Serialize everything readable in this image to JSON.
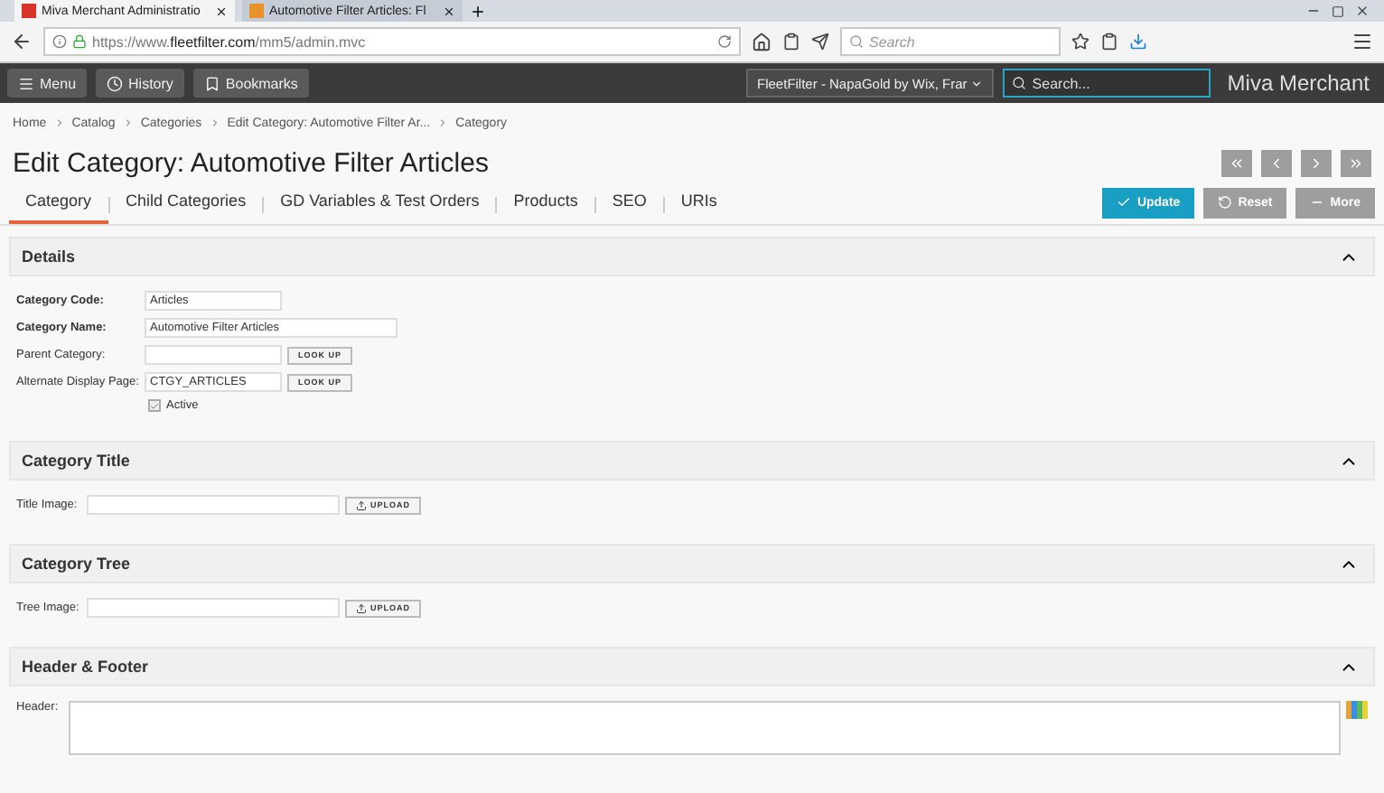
{
  "browser": {
    "tabs": [
      {
        "title": "Miva Merchant Administratio",
        "selected": true
      },
      {
        "title": "Automotive Filter Articles: Fl",
        "selected": false
      }
    ],
    "url_prefix": "https://www.",
    "url_domain": "fleetfilter.com",
    "url_path": "/mm5/admin.mvc",
    "search_placeholder": "Search"
  },
  "appbar": {
    "buttons": [
      "Menu",
      "History",
      "Bookmarks"
    ],
    "store": "FleetFilter - NapaGold by Wix, Frar",
    "search_placeholder": "Search...",
    "brand": "Miva Merchant"
  },
  "breadcrumbs": [
    "Home",
    "Catalog",
    "Categories",
    "Edit Category: Automotive Filter Ar...",
    "Category"
  ],
  "title": "Edit Category: Automotive Filter Articles",
  "tabs": [
    {
      "label": "Category",
      "selected": true
    },
    {
      "label": "Child Categories",
      "selected": false
    },
    {
      "label": "GD Variables & Test Orders",
      "selected": false
    },
    {
      "label": "Products",
      "selected": false
    },
    {
      "label": "SEO",
      "selected": false
    },
    {
      "label": "URIs",
      "selected": false
    }
  ],
  "actions": [
    {
      "label": "Update",
      "kind": "primary"
    },
    {
      "label": "Reset",
      "kind": "reset"
    },
    {
      "label": "More",
      "kind": "more"
    }
  ],
  "sections": [
    {
      "title": "Details",
      "expanded": true,
      "fields": [
        {
          "kind": "text",
          "label": "Category Code:",
          "bold": true,
          "value": "Articles"
        },
        {
          "kind": "text",
          "label": "Category Name:",
          "bold": true,
          "value": "Automotive Filter Articles"
        },
        {
          "kind": "lookup",
          "label": "Parent Category:",
          "bold": false,
          "button": "LOOK UP"
        },
        {
          "kind": "lookup",
          "label": "Alternate Display Page:",
          "bold": false,
          "value": "CTGY_ARTICLES",
          "button": "LOOK UP"
        },
        {
          "kind": "checkbox",
          "label": "Active",
          "checked": true
        }
      ]
    },
    {
      "title": "Category Title",
      "expanded": true,
      "fields": [
        {
          "kind": "upload",
          "label": "Title Image:",
          "bold": false,
          "button": "UPLOAD"
        }
      ]
    },
    {
      "title": "Category Tree",
      "expanded": true,
      "fields": [
        {
          "kind": "upload",
          "label": "Tree Image:",
          "bold": false,
          "button": "UPLOAD"
        }
      ]
    },
    {
      "title": "Header & Footer",
      "expanded": true,
      "fields": [
        {
          "kind": "textarea",
          "label": "Header:",
          "bold": false
        }
      ]
    }
  ]
}
